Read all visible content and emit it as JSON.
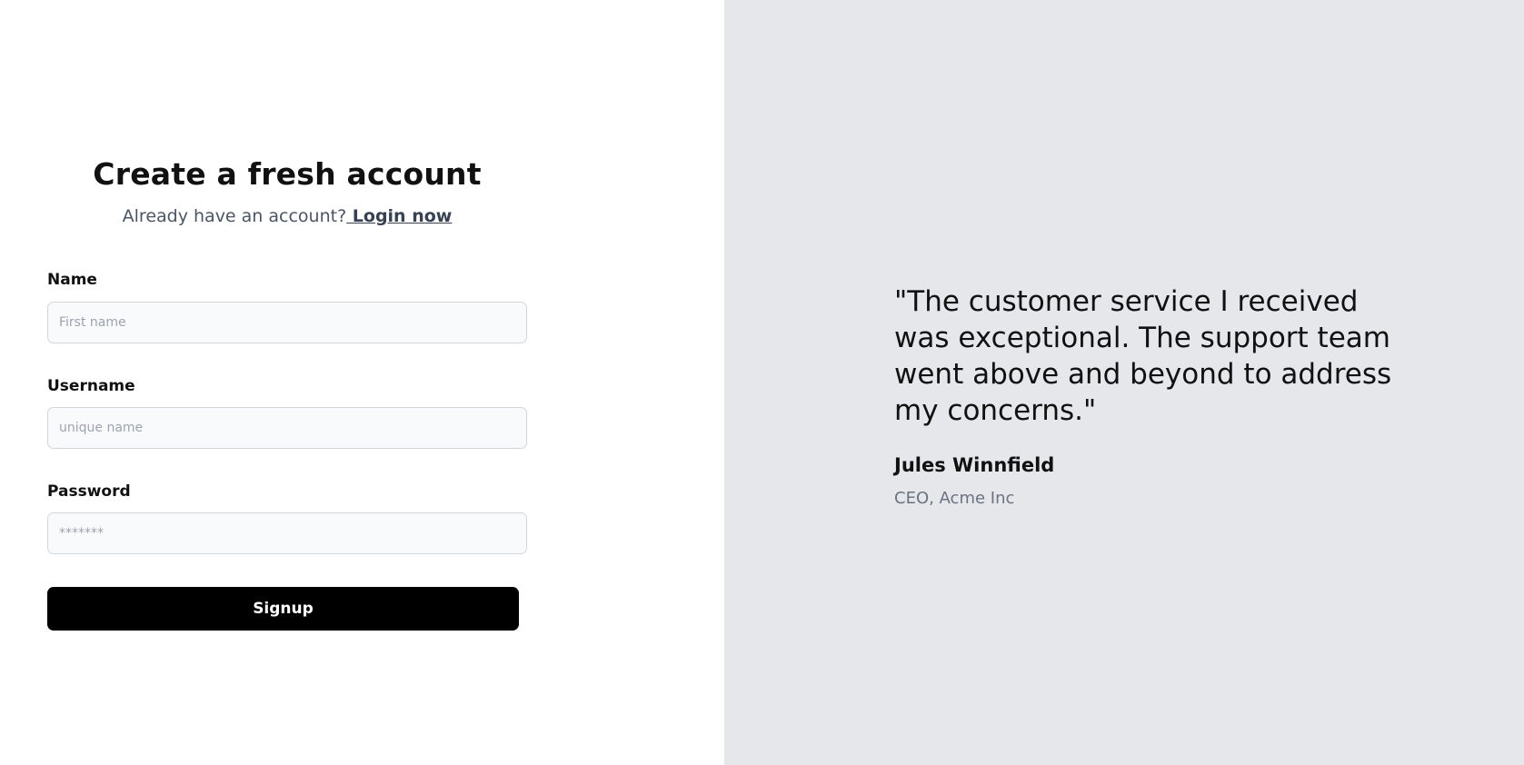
{
  "signup": {
    "title": "Create a fresh account",
    "subtitle_text": "Already have an account?",
    "login_link": " Login now",
    "fields": [
      {
        "label": "Name",
        "placeholder": "First name",
        "value": ""
      },
      {
        "label": "Username",
        "placeholder": "unique name",
        "value": ""
      },
      {
        "label": "Password",
        "placeholder": "*******",
        "value": ""
      }
    ],
    "submit_label": "Signup"
  },
  "testimonial": {
    "quote": "\"The customer service I received was exceptional. The support team went above and beyond to address my concerns.\"",
    "author_name": "Jules Winnfield",
    "author_role": "CEO, Acme Inc"
  },
  "colors": {
    "primary_button": "#000000",
    "testimonial_background": "#e5e7eb",
    "input_background": "#f9fafb"
  }
}
